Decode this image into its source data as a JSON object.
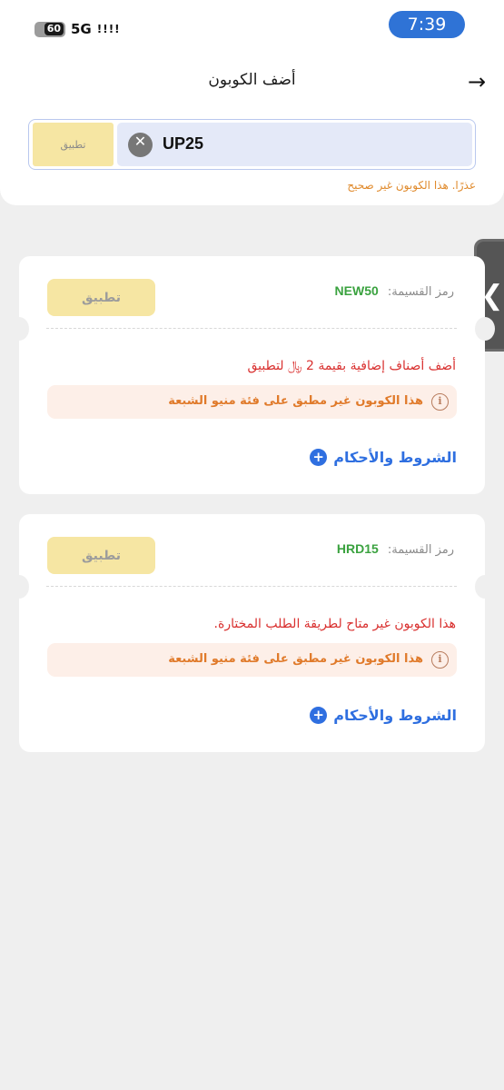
{
  "status_bar": {
    "battery": "60",
    "network": "5G",
    "time": "7:39"
  },
  "header": {
    "title": "أضف الكوبون",
    "back_icon": "arrow-right-icon"
  },
  "coupon_entry": {
    "value": "UP25",
    "apply_label": "تطبيق",
    "error": "عذرًا. هذا الكوبون غير صحيح"
  },
  "coupons": [
    {
      "code_label": "رمز القسيمة:",
      "code": "NEW50",
      "apply_label": "تطبيق",
      "message": "أضف أصناف إضافية بقيمة 2 ﷼ لتطبيق",
      "warning": "هذا الكوبون غير مطبق على فئة منيو الشبعة",
      "terms_label": "الشروط والأحكام"
    },
    {
      "code_label": "رمز القسيمة:",
      "code": "HRD15",
      "apply_label": "تطبيق",
      "message": "هذا الكوبون غير متاح لطريقة الطلب المختارة.",
      "warning": "هذا الكوبون غير مطبق على فئة منيو الشبعة",
      "terms_label": "الشروط والأحكام"
    }
  ],
  "colors": {
    "accent_blue": "#2f6fe0",
    "code_green": "#3aa23f",
    "error_red": "#d9302f",
    "warning_orange": "#e07a2a",
    "apply_yellow": "#f6e6a3"
  }
}
